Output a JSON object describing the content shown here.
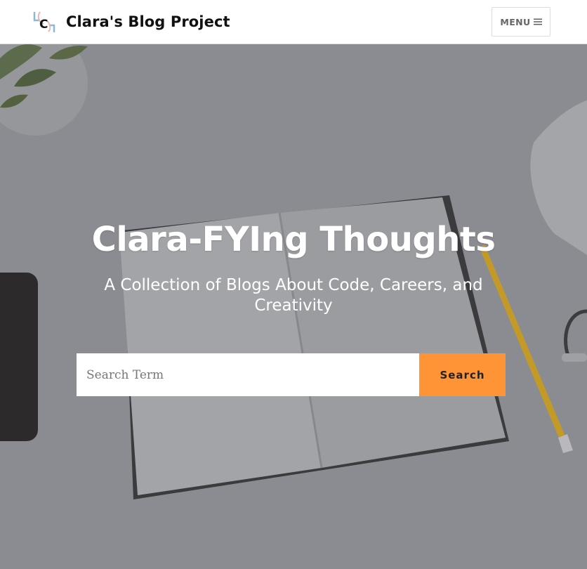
{
  "navbar": {
    "brand_title": "Clara's Blog Project",
    "logo_letter": "C",
    "menu_label": "MENU",
    "menu_icon": "hamburger-icon"
  },
  "hero": {
    "title": "Clara-FYIng Thoughts",
    "subtitle": "A Collection of Blogs About Code, Careers, and Creativity",
    "background": "desk-with-open-notebook-pencil-plant-photo"
  },
  "search": {
    "placeholder": "Search Term",
    "value": "",
    "button_label": "Search"
  },
  "colors": {
    "accent": "#ff9436",
    "navbar_bg": "#ffffff",
    "hero_text": "#ffffff"
  }
}
